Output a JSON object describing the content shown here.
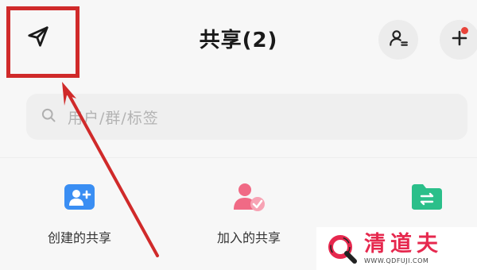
{
  "header": {
    "title": "共享(2)"
  },
  "search": {
    "placeholder": "用户/群/标签"
  },
  "grid": {
    "items": [
      {
        "label": "创建的共享",
        "icon": "add-user-icon",
        "color": "#3a8ef3"
      },
      {
        "label": "加入的共享",
        "icon": "joined-users-icon",
        "color": "#f06a85"
      },
      {
        "label": "",
        "icon": "shared-folder-icon",
        "color": "#2bbf8a"
      }
    ]
  },
  "watermark": {
    "title": "清道夫",
    "url": "WWW.QDFUJI.COM"
  },
  "colors": {
    "highlight": "#d02a2a",
    "badge": "#e8443a"
  }
}
